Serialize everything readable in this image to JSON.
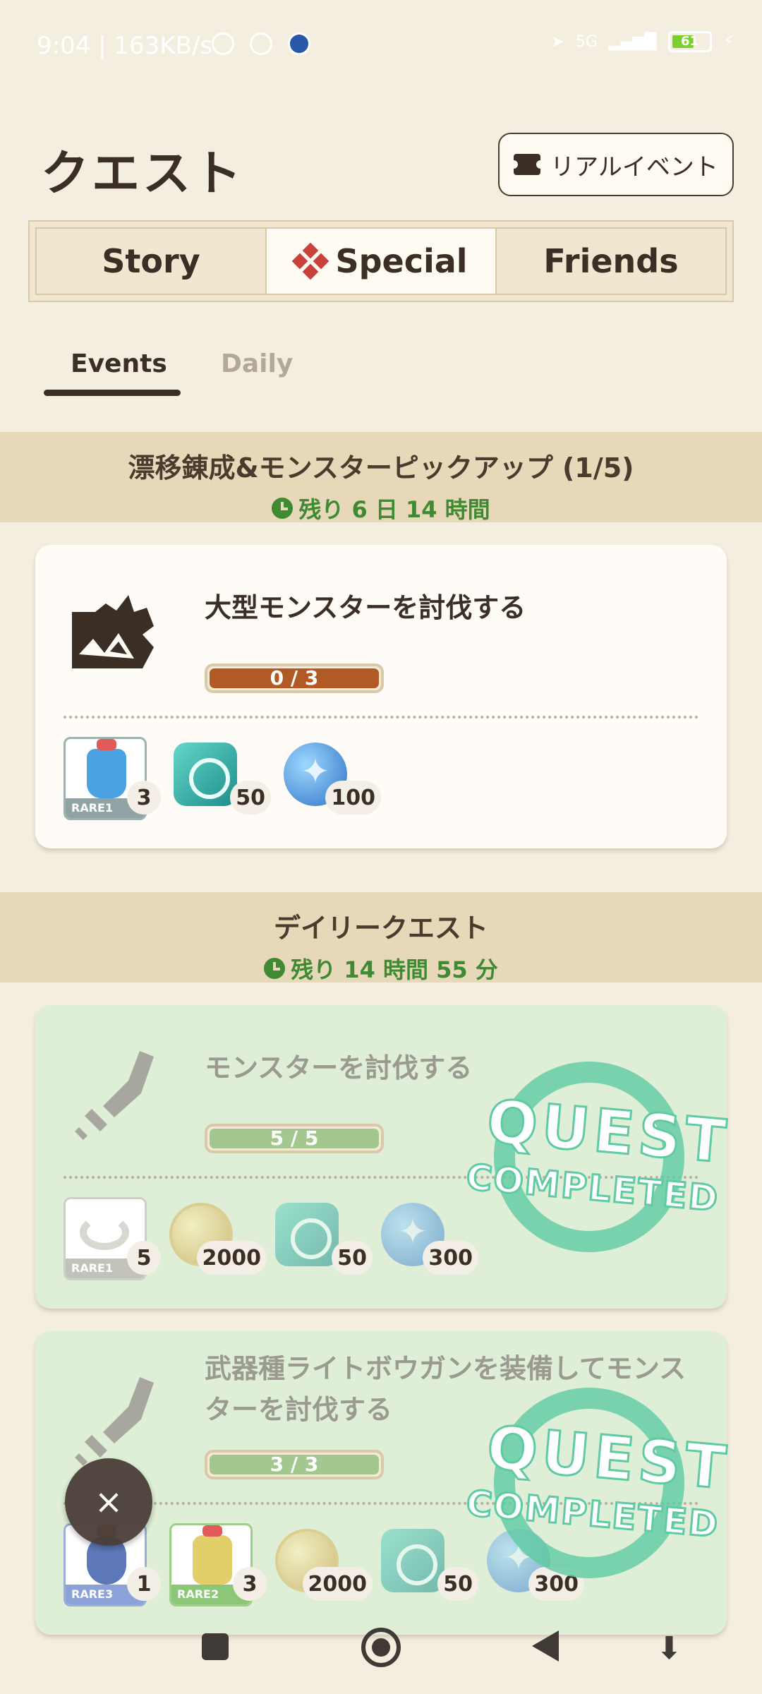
{
  "status_bar": {
    "time_speed": "9:04 | 163KB/s",
    "battery": "61",
    "network": "5G"
  },
  "header": {
    "title": "クエスト",
    "real_event_label": "リアルイベント"
  },
  "main_tabs": [
    {
      "label": "Story"
    },
    {
      "label": "Special"
    },
    {
      "label": "Friends"
    }
  ],
  "sub_tabs": [
    {
      "label": "Events"
    },
    {
      "label": "Daily"
    }
  ],
  "sections": [
    {
      "title": "漂移錬成&モンスターピックアップ (1/5)",
      "timer": "残り 6 日 14 時間",
      "quests": [
        {
          "title": "大型モンスターを討伐する",
          "progress": "0 / 3",
          "progress_fraction": 0.0,
          "completed": false,
          "rewards": [
            {
              "icon": "potion-icon",
              "count": "3",
              "rarity": "RARE1"
            },
            {
              "icon": "teal-gem-icon",
              "count": "50"
            },
            {
              "icon": "blue-orb-icon",
              "count": "100"
            }
          ]
        }
      ]
    },
    {
      "title": "デイリークエスト",
      "timer": "残り 14 時間 55 分",
      "quests": [
        {
          "title": "モンスターを討伐する",
          "progress": "5 / 5",
          "progress_fraction": 1.0,
          "completed": true,
          "stamp": {
            "line1": "QUEST",
            "line2": "COMPLETED"
          },
          "rewards": [
            {
              "icon": "bone-icon",
              "count": "5",
              "rarity": "RARE1"
            },
            {
              "icon": "gold-coin-icon",
              "count": "2000"
            },
            {
              "icon": "teal-gem-icon",
              "count": "50"
            },
            {
              "icon": "blue-orb-icon",
              "count": "300"
            }
          ]
        },
        {
          "title": "武器種ライトボウガンを装備してモンスターを討伐する",
          "progress": "3 / 3",
          "progress_fraction": 1.0,
          "completed": true,
          "stamp": {
            "line1": "QUEST",
            "line2": "COMPLETED"
          },
          "rewards": [
            {
              "icon": "pouch-icon",
              "count": "1",
              "rarity": "RARE3"
            },
            {
              "icon": "yellow-item-icon",
              "count": "3",
              "rarity": "RARE2"
            },
            {
              "icon": "gold-coin-icon",
              "count": "2000"
            },
            {
              "icon": "teal-gem-icon",
              "count": "50"
            },
            {
              "icon": "blue-orb-icon",
              "count": "300"
            }
          ]
        }
      ]
    }
  ],
  "fab_close": "×",
  "colors": {
    "background": "#f4eee0",
    "section_header": "#e6d8b8",
    "timer_green": "#3f8a32",
    "progress_active": "#b25a25",
    "progress_done": "#a4c68f",
    "completed_card": "#dfeed6",
    "stamp": "#5fcaa4"
  }
}
